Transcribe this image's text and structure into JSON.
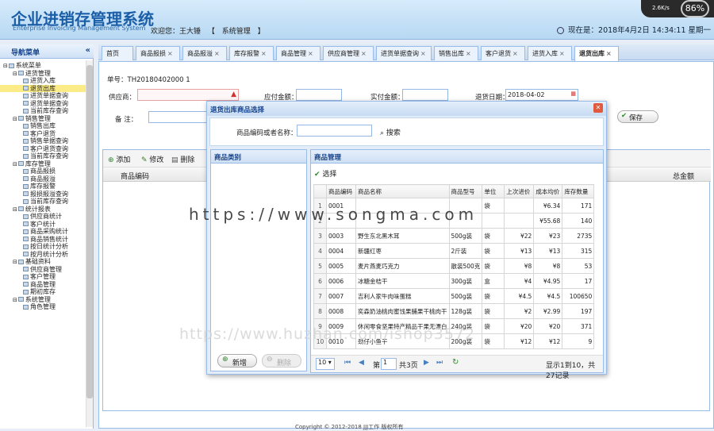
{
  "header": {
    "title": "企业进销存管理系统",
    "subtitle": "Enterprise Invoicing Management System",
    "welcome": "欢迎您：王大锤",
    "bracket_open": "【",
    "system_admin": "系统管理",
    "bracket_close": "】",
    "datetime": "现在是：2018年4月2日  14:34:11  星期一"
  },
  "netmeter": {
    "speed": "2.6K/s",
    "percent": "86%"
  },
  "sidebar": {
    "title": "导航菜单",
    "tree": [
      {
        "label": "系统菜单",
        "level": 0
      },
      {
        "label": "进货管理",
        "level": 1
      },
      {
        "label": "进货入库",
        "level": 2
      },
      {
        "label": "退货出库",
        "level": 2,
        "selected": true
      },
      {
        "label": "进货单据查询",
        "level": 2
      },
      {
        "label": "退货单据查询",
        "level": 2
      },
      {
        "label": "当前库存查询",
        "level": 2
      },
      {
        "label": "销售管理",
        "level": 1
      },
      {
        "label": "销售出库",
        "level": 2
      },
      {
        "label": "客户退货",
        "level": 2
      },
      {
        "label": "销售单据查询",
        "level": 2
      },
      {
        "label": "客户退货查询",
        "level": 2
      },
      {
        "label": "当前库存查询",
        "level": 2
      },
      {
        "label": "库存管理",
        "level": 1
      },
      {
        "label": "商品报损",
        "level": 2
      },
      {
        "label": "商品报溢",
        "level": 2
      },
      {
        "label": "库存报警",
        "level": 2
      },
      {
        "label": "报损报溢查询",
        "level": 2
      },
      {
        "label": "当前库存查询",
        "level": 2
      },
      {
        "label": "统计报表",
        "level": 1
      },
      {
        "label": "供应商统计",
        "level": 2
      },
      {
        "label": "客户统计",
        "level": 2
      },
      {
        "label": "商品采购统计",
        "level": 2
      },
      {
        "label": "商品销售统计",
        "level": 2
      },
      {
        "label": "按日统计分析",
        "level": 2
      },
      {
        "label": "按月统计分析",
        "level": 2
      },
      {
        "label": "基础资料",
        "level": 1
      },
      {
        "label": "供应商管理",
        "level": 2
      },
      {
        "label": "客户管理",
        "level": 2
      },
      {
        "label": "商品管理",
        "level": 2
      },
      {
        "label": "期初库存",
        "level": 2
      },
      {
        "label": "系统管理",
        "level": 1
      },
      {
        "label": "角色管理",
        "level": 2
      }
    ]
  },
  "tabs": [
    "首页",
    "商品报损",
    "商品报溢",
    "库存报警",
    "商品管理",
    "供应商管理",
    "进货单据查询",
    "销售出库",
    "客户退货",
    "进货入库",
    "退货出库"
  ],
  "form": {
    "order_no": "单号：TH20180402000 1",
    "supplier_label": "供应商：",
    "payable_label": "应付金额：",
    "paid_label": "实付金额：",
    "date_label": "退货日期：",
    "date_value": "2018-04-02",
    "remark_label": "备      注：",
    "save_label": "保存"
  },
  "grid": {
    "add": "添加",
    "edit": "修改",
    "delete": "删除",
    "col_code": "商品编码",
    "col_total": "总金额"
  },
  "dialog": {
    "title": "退货出库商品选择",
    "search_label": "商品编码或者名称：",
    "search_button": "搜索",
    "category_title": "商品类别",
    "goods_title": "商品管理",
    "select_label": "选择",
    "new_label": "新增",
    "delete_label": "删除",
    "columns": [
      "商品编码",
      "商品名称",
      "商品型号",
      "单位",
      "上次进价",
      "成本均价",
      "库存数量"
    ],
    "rows": [
      {
        "n": "1",
        "code": "0001",
        "name": "",
        "model": "",
        "unit": "袋",
        "last": "",
        "avg": "¥6.34",
        "stock": "171"
      },
      {
        "n": "2",
        "code": "",
        "name": "",
        "model": "",
        "unit": "",
        "last": "",
        "avg": "¥55.68",
        "stock": "140"
      },
      {
        "n": "3",
        "code": "0003",
        "name": "野生东北黑木耳",
        "model": "500g装",
        "unit": "袋",
        "last": "¥22",
        "avg": "¥23",
        "stock": "2735"
      },
      {
        "n": "4",
        "code": "0004",
        "name": "新疆红枣",
        "model": "2斤装",
        "unit": "袋",
        "last": "¥13",
        "avg": "¥13",
        "stock": "315"
      },
      {
        "n": "5",
        "code": "0005",
        "name": "麦片燕麦巧克力",
        "model": "散装500克",
        "unit": "袋",
        "last": "¥8",
        "avg": "¥8",
        "stock": "53"
      },
      {
        "n": "6",
        "code": "0006",
        "name": "冰糖金桔干",
        "model": "300g装",
        "unit": "盒",
        "last": "¥4",
        "avg": "¥4.95",
        "stock": "17"
      },
      {
        "n": "7",
        "code": "0007",
        "name": "吉利人家牛肉味蛋糕",
        "model": "500g装",
        "unit": "袋",
        "last": "¥4.5",
        "avg": "¥4.5",
        "stock": "100650"
      },
      {
        "n": "8",
        "code": "0008",
        "name": "奕森奶油桃肉蜜饯果脯果干桃肉干",
        "model": "128g装",
        "unit": "袋",
        "last": "¥2",
        "avg": "¥2.99",
        "stock": "197"
      },
      {
        "n": "9",
        "code": "0009",
        "name": "休闲零食坚果特产精品干果无漂白",
        "model": "240g装",
        "unit": "袋",
        "last": "¥20",
        "avg": "¥20",
        "stock": "371"
      },
      {
        "n": "10",
        "code": "0010",
        "name": "劲仔小鱼干",
        "model": "200g装",
        "unit": "袋",
        "last": "¥12",
        "avg": "¥12",
        "stock": "9"
      }
    ],
    "pager": {
      "size": "10",
      "page_prefix": "第",
      "page": "1",
      "page_suffix": "共3页",
      "info": "显示1到10，共27记录"
    }
  },
  "watermark": {
    "line1": "https://www.songma.com",
    "line2": "https://www.huzhan.com/ishop3572"
  },
  "footer": "Copyright © 2012-2018 JJJ工作 版权所有"
}
